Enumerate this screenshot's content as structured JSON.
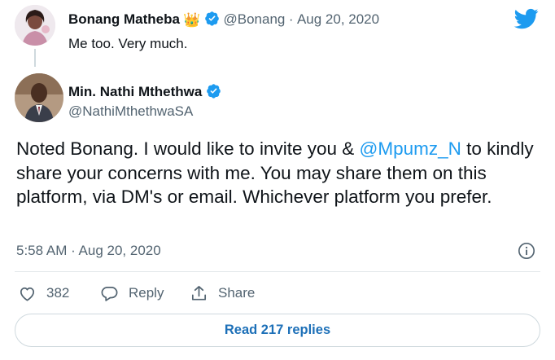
{
  "parent_tweet": {
    "name": "Bonang Matheba",
    "emoji": "👑",
    "handle": "@Bonang",
    "separator": "·",
    "date": "Aug 20, 2020",
    "text": "Me too. Very much."
  },
  "main_tweet": {
    "name": "Min. Nathi Mthethwa",
    "handle": "@NathiMthethwaSA",
    "text_before": "Noted Bonang. I would like to invite you & ",
    "mention": "@Mpumz_N",
    "text_after": " to kindly share your concerns with me. You may share them on this platform, via DM's or email. Whichever platform you prefer.",
    "timestamp": "5:58 AM · Aug 20, 2020"
  },
  "actions": {
    "like_count": "382",
    "reply_label": "Reply",
    "share_label": "Share"
  },
  "read_replies_label": "Read 217 replies",
  "icons": {
    "brand": "twitter-bird-icon",
    "verified": "verified-badge-icon",
    "like": "heart-icon",
    "reply": "speech-bubble-icon",
    "share": "share-upload-icon",
    "info": "info-icon"
  },
  "colors": {
    "accent": "#1d9bf0",
    "text": "#0f1419",
    "secondary": "#536471",
    "read_button_text": "#1d70b8"
  }
}
